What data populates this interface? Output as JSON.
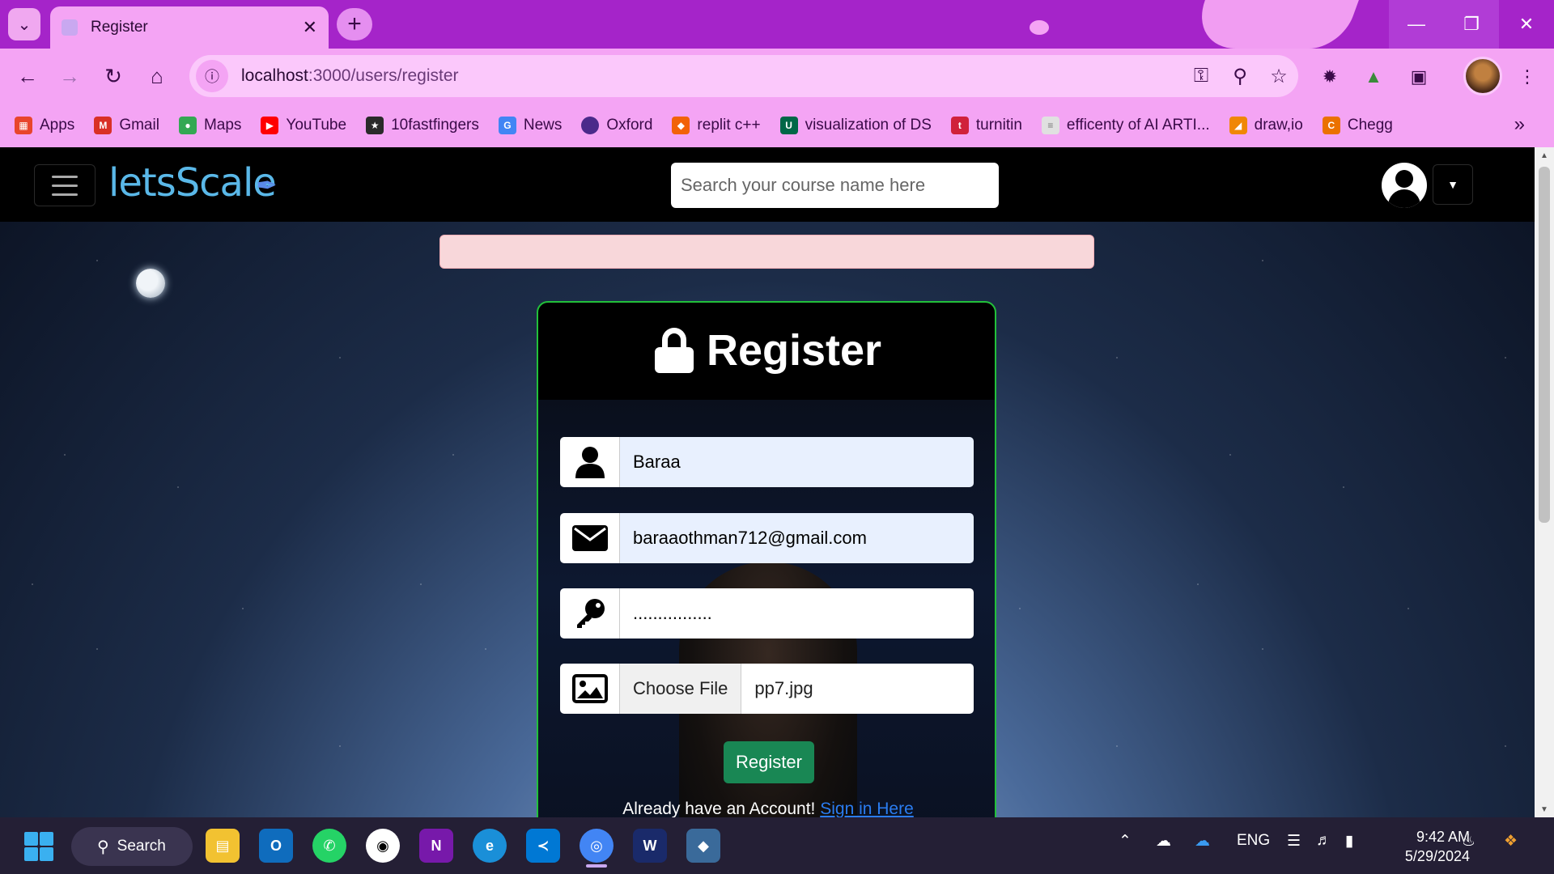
{
  "browser": {
    "tab_title": "Register",
    "url_host": "localhost",
    "url_path": ":3000/users/register",
    "bookmarks": [
      "Apps",
      "Gmail",
      "Maps",
      "YouTube",
      "10fastfingers",
      "News",
      "Oxford",
      "replit c++",
      "visualization of DS",
      "turnitin",
      "efficenty of AI ARTI...",
      "draw,io",
      "Chegg"
    ]
  },
  "navbar": {
    "brand": "letsScale",
    "search_placeholder": "Search your course name here"
  },
  "form": {
    "title": "Register",
    "name_value": "Baraa",
    "email_value": "baraaothman712@gmail.com",
    "password_value": "................",
    "file_button": "Choose File",
    "file_name": "pp7.jpg",
    "submit_label": "Register",
    "signin_text": "Already have an Account!",
    "signin_link": "Sign in Here"
  },
  "taskbar": {
    "search_label": "Search",
    "language": "ENG",
    "time": "9:42 AM",
    "date": "5/29/2024"
  },
  "colors": {
    "chrome_theme": "#a524c9",
    "toolbar": "#f4a4f4",
    "card_border": "#22c03a",
    "register_button": "#198754",
    "link": "#2a7cf0",
    "alert_bg": "#f8d7da"
  }
}
